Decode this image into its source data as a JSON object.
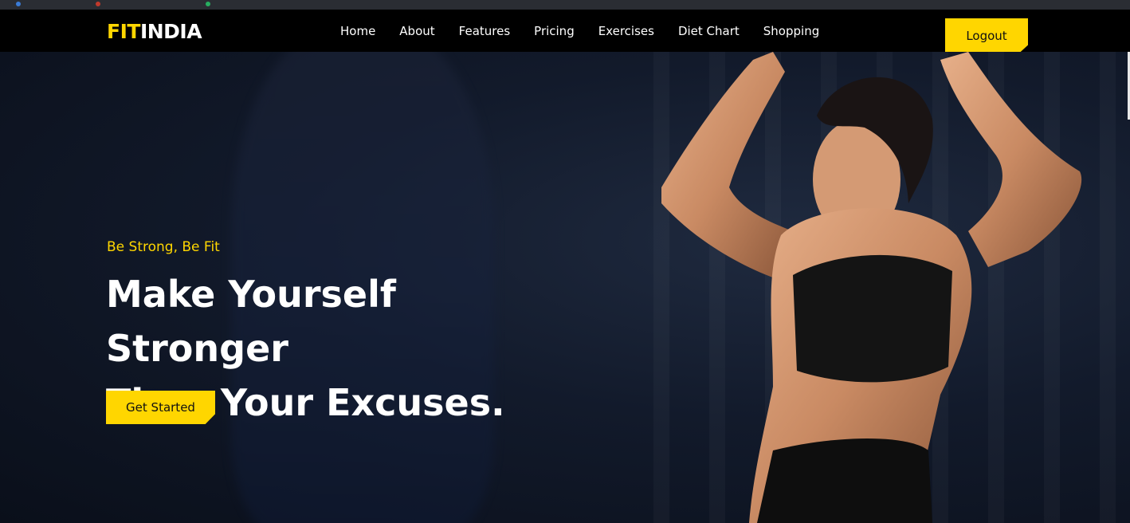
{
  "brand": {
    "part1": "FIT",
    "part2": "INDIA"
  },
  "nav": {
    "links": [
      "Home",
      "About",
      "Features",
      "Pricing",
      "Exercises",
      "Diet Chart",
      "Shopping"
    ],
    "logout_label": "Logout"
  },
  "hero": {
    "tagline": "Be Strong, Be Fit",
    "headline_line1": "Make Yourself Stronger",
    "headline_line2": "Than Your Excuses.",
    "cta_label": "Get Started",
    "image": "woman-athlete-flexing-photo"
  },
  "colors": {
    "accent": "#ffd600",
    "nav_bg": "#000000",
    "hero_bg": "#0d1424",
    "text": "#ffffff"
  }
}
